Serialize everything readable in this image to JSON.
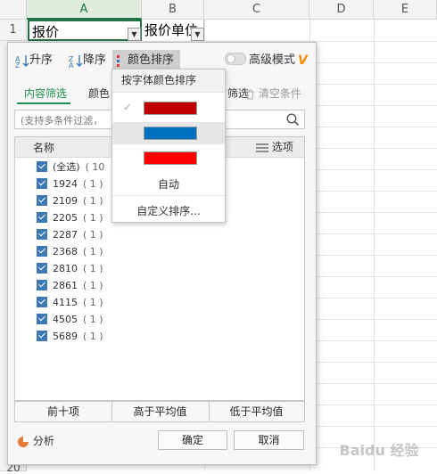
{
  "sheet": {
    "columns": [
      "A",
      "B",
      "C",
      "D",
      "E"
    ],
    "rows": [
      "1",
      "20"
    ],
    "cells": {
      "a1": "报价",
      "b1": "报价单位"
    }
  },
  "toolbar": {
    "sort_asc": "升序",
    "sort_desc": "降序",
    "color_sort": "颜色排序",
    "advanced_mode": "高级模式",
    "vip_badge": "V"
  },
  "tabs": {
    "content_filter": "内容筛选",
    "color_filter": "颜色",
    "text_filter": "筛选",
    "clear": "清空条件"
  },
  "search": {
    "placeholder": "(支持多条件过滤，"
  },
  "list": {
    "header_name": "名称",
    "options_label": "选项",
    "items": [
      {
        "label": "(全选)",
        "count": "( 10"
      },
      {
        "label": "1924",
        "count": "( 1 )"
      },
      {
        "label": "2109",
        "count": "( 1 )"
      },
      {
        "label": "2205",
        "count": "( 1 )"
      },
      {
        "label": "2287",
        "count": "( 1 )"
      },
      {
        "label": "2368",
        "count": "( 1 )"
      },
      {
        "label": "2810",
        "count": "( 1 )"
      },
      {
        "label": "2861",
        "count": "( 1 )"
      },
      {
        "label": "4115",
        "count": "( 1 )"
      },
      {
        "label": "4505",
        "count": "( 1 )"
      },
      {
        "label": "5689",
        "count": "( 1 )"
      }
    ]
  },
  "quick": {
    "top10": "前十项",
    "above_avg": "高于平均值",
    "below_avg": "低于平均值"
  },
  "footer": {
    "analysis": "分析",
    "ok": "确定",
    "cancel": "取消"
  },
  "menu": {
    "title": "按字体颜色排序",
    "colors": [
      "#c00000",
      "#0070c0",
      "#ff0000"
    ],
    "auto": "自动",
    "custom": "自定义排序..."
  },
  "watermark": "Baidu 经验"
}
